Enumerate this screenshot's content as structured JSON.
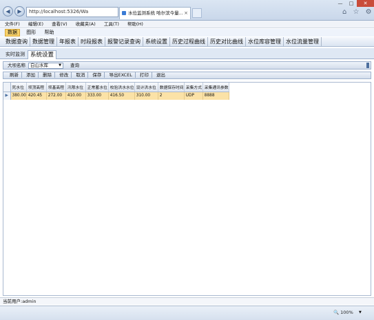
{
  "browser": {
    "address": "http://localhost:5326/Wa",
    "address_icons": "ρ ▾ ≡ ¢ ×",
    "tab_title": "水位监测系统 哈尔滨今量...",
    "tab_close": "×",
    "back": "◀",
    "forward": "▶",
    "win_min": "—",
    "win_max": "□",
    "win_close": "✕",
    "right_icons": "⌂ ☆ ⚙"
  },
  "ie_menu": [
    "文件(F)",
    "编辑(E)",
    "查看(V)",
    "收藏夹(A)",
    "工具(T)",
    "帮助(H)"
  ],
  "app_menu": [
    "数据",
    "图形",
    "帮助"
  ],
  "module_tabs": [
    "数据查询",
    "数据管理",
    "年报表",
    "时段报表",
    "报警记录查询",
    "系统设置",
    "历史过程曲线",
    "历史对比曲线",
    "水位库容管理",
    "水位流量管理"
  ],
  "sub_tabs": [
    "实时监测",
    "系统设置"
  ],
  "filter": {
    "label": "大坝名称",
    "selected": "白山水库",
    "query_button": "查询"
  },
  "actions": [
    "刷新",
    "添加",
    "删除",
    "修改",
    "取消",
    "保存",
    "导出EXCEL",
    "打印",
    "退出"
  ],
  "grid": {
    "columns": [
      "死水位",
      "坝顶高程",
      "坝基高程",
      "汛限水位",
      "正常蓄水位",
      "校验洪水水位",
      "设计洪水位",
      "数据保存时间",
      "采集方式",
      "采集通讯参数"
    ],
    "rows": [
      [
        "380.00",
        "420.45",
        "272.00",
        "410.00",
        "333.00",
        "416.50",
        "310.00",
        "2",
        "UDP",
        "8888"
      ]
    ],
    "row_marker": "▶"
  },
  "status": {
    "user": "当前用户:admin",
    "zoom": "🔍 100%"
  }
}
